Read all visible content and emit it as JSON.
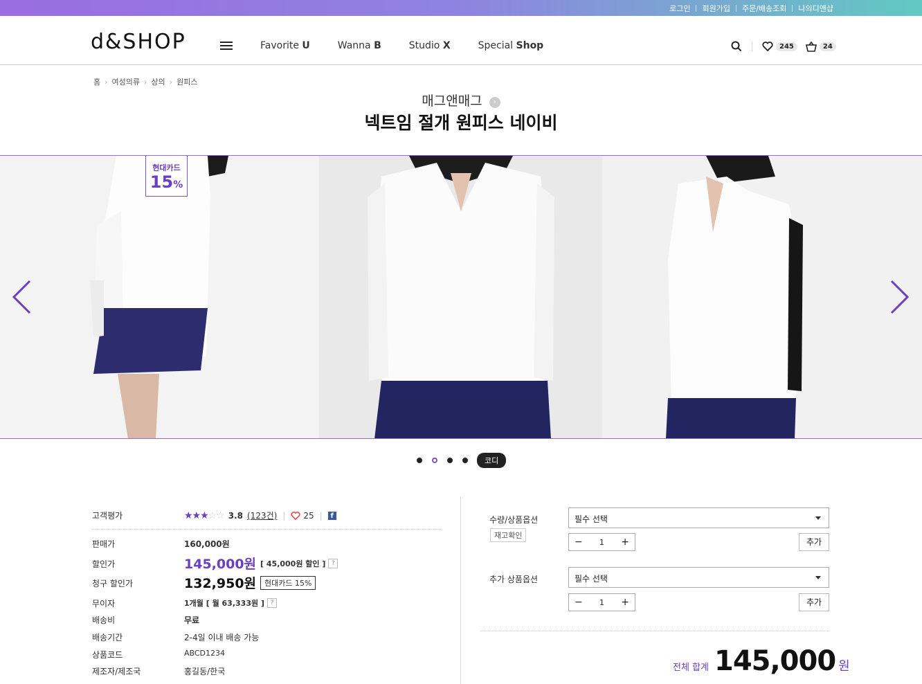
{
  "topbar": {
    "links": [
      "로그인",
      "회원가입",
      "주문/배송조회",
      "나의디앤샵"
    ]
  },
  "header": {
    "logo": "d&SHOP",
    "menu_icon": "hamburger-icon",
    "nav": [
      {
        "pre": "Favorite ",
        "bold": "U"
      },
      {
        "pre": "Wanna ",
        "bold": "B"
      },
      {
        "pre": "Studio ",
        "bold": "X"
      },
      {
        "pre": "Special ",
        "bold": "Shop"
      }
    ],
    "wish_count": "245",
    "cart_count": "24"
  },
  "breadcrumb": [
    "홈",
    "여성의류",
    "상의",
    "원피스"
  ],
  "product": {
    "brand": "매그앤매그",
    "title": "넥트임 절개 원피스 네이비"
  },
  "gallery": {
    "badge_card": "현대카드",
    "badge_percent": "15",
    "badge_unit": "%",
    "dots_count": 4,
    "active_dot": 1,
    "codi_label": "코디",
    "accent": "#7a55c8"
  },
  "info": {
    "rating_label": "고객평가",
    "rating_score": "3.8",
    "rating_count": "(123건)",
    "rating_stars": 3,
    "likes": "25",
    "price_label": "판매가",
    "price": "160,000원",
    "discount_label": "할인가",
    "discount_price": "145,000원",
    "discount_note": "[ 45,000원 할인 ]",
    "claim_label": "청구 할인가",
    "claim_price": "132,950원",
    "claim_card": "현대카드 15%",
    "installment_label": "무이자",
    "installment": "1개월 [ 월 63,333원 ]",
    "shipping_label": "배송비",
    "shipping": "무료",
    "period_label": "배송기간",
    "period": "2-4일 이내 배송 가능",
    "code_label": "상품코드",
    "code": "ABCD1234",
    "maker_label": "제조자/제조국",
    "maker": "홍길동/한국"
  },
  "options": {
    "qty_option_label": "수량/상품옵션",
    "stock_check": "재고확인",
    "select1": "필수 선택",
    "qty1": "1",
    "add1": "추가",
    "extra_option_label": "추가 상품옵션",
    "select2": "필수 선택",
    "qty2": "1",
    "add2": "추가",
    "total_label": "전체 합계",
    "total_value": "145,000",
    "total_unit": "원"
  }
}
